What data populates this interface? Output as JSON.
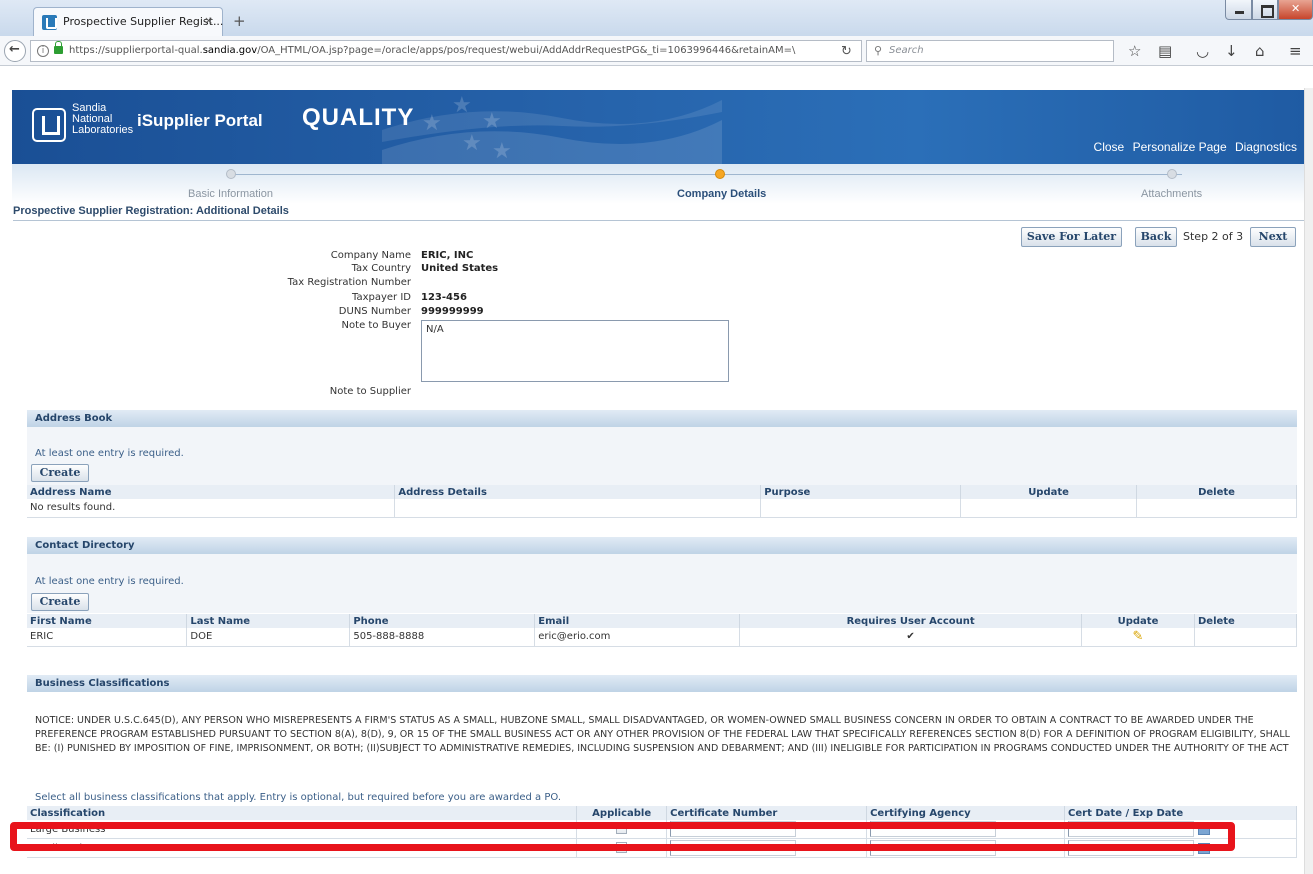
{
  "browser": {
    "tab_title": "Prospective Supplier Regist...",
    "tab_close": "×",
    "new_tab": "+",
    "url_prefix": "https://supplierportal-qual.",
    "url_domain": "sandia.gov",
    "url_rest": "/OA_HTML/OA.jsp?page=/oracle/apps/pos/request/webui/AddAddrRequestPG&_ti=1063996446&retainAM=\\",
    "search_placeholder": "Search"
  },
  "header": {
    "logo_line1": "Sandia",
    "logo_line2": "National",
    "logo_line3": "Laboratories",
    "brand": "iSupplier Portal",
    "env": "QUALITY",
    "links": [
      "Close",
      "Personalize Page",
      "Diagnostics"
    ]
  },
  "train": {
    "steps": [
      {
        "label": "Basic Information",
        "active": false
      },
      {
        "label": "Company Details",
        "active": true
      },
      {
        "label": "Attachments",
        "active": false
      }
    ]
  },
  "page_title": "Prospective Supplier Registration: Additional Details",
  "actions": {
    "save_for_later": "Save For Later",
    "back": "Back",
    "step_text": "Step 2 of 3",
    "next": "Next"
  },
  "company": {
    "labels": {
      "company_name": "Company Name",
      "tax_country": "Tax Country",
      "tax_reg": "Tax Registration Number",
      "taxpayer_id": "Taxpayer ID",
      "duns": "DUNS Number",
      "note_buyer": "Note to Buyer",
      "note_supplier": "Note to Supplier"
    },
    "values": {
      "company_name": "ERIC, INC",
      "tax_country": "United States",
      "taxpayer_id": "123-456",
      "duns": "999999999",
      "note_buyer": "N/A"
    }
  },
  "address_book": {
    "title": "Address Book",
    "hint": "At least one entry is required.",
    "create": "Create",
    "columns": [
      "Address Name",
      "Address Details",
      "Purpose",
      "Update",
      "Delete"
    ],
    "empty": "No results found."
  },
  "contacts": {
    "title": "Contact Directory",
    "hint": "At least one entry is required.",
    "create": "Create",
    "columns": [
      "First Name",
      "Last Name",
      "Phone",
      "Email",
      "Requires User Account",
      "Update",
      "Delete"
    ],
    "rows": [
      {
        "first": "ERIC",
        "last": "DOE",
        "phone": "505-888-8888",
        "email": "eric@erio.com",
        "requires": "✔"
      }
    ]
  },
  "business": {
    "title": "Business Classifications",
    "notice": "NOTICE: UNDER U.S.C.645(D), ANY PERSON WHO MISREPRESENTS A FIRM'S STATUS AS A SMALL, HUBZONE SMALL, SMALL DISADVANTAGED, OR WOMEN-OWNED SMALL BUSINESS CONCERN IN ORDER TO OBTAIN A CONTRACT TO BE AWARDED UNDER THE PREFERENCE PROGRAM ESTABLISHED PURSUANT TO SECTION 8(A), 8(D), 9, OR 15 OF THE SMALL BUSINESS ACT OR ANY OTHER PROVISION OF THE FEDERAL LAW THAT SPECIFICALLY REFERENCES SECTION 8(D) FOR A DEFINITION OF PROGRAM ELIGIBILITY, SHALL BE: (I) PUNISHED BY IMPOSITION OF FINE, IMPRISONMENT, OR BOTH; (II)SUBJECT TO ADMINISTRATIVE REMEDIES, INCLUDING SUSPENSION AND DEBARMENT; AND (III) INELIGIBLE FOR PARTICIPATION IN PROGRAMS CONDUCTED UNDER THE AUTHORITY OF THE ACT",
    "select_note": "Select all business classifications that apply. Entry is optional, but required before you are awarded a PO.",
    "columns": [
      "Classification",
      "Applicable",
      "Certificate Number",
      "Certifying Agency",
      "Cert Date / Exp Date"
    ],
    "rows": [
      "Large Business",
      "Small Business"
    ]
  },
  "colors": {
    "header_blue": "#2663ab",
    "active_step": "#f6a623",
    "highlight": "#e8141b"
  }
}
